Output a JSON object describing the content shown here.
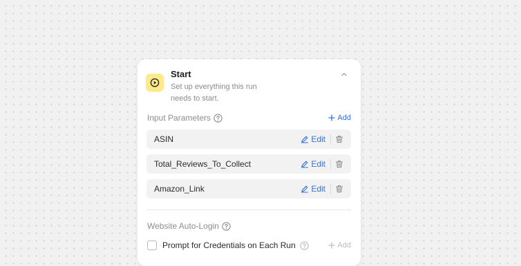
{
  "start_node": {
    "title": "Start",
    "subtitle": "Set up everything this run needs to start.",
    "icon": "play-icon",
    "icon_bg": "#fbe98a",
    "collapsed": false
  },
  "input_parameters": {
    "label": "Input Parameters",
    "add_label": "Add",
    "items": [
      {
        "name": "ASIN",
        "edit_label": "Edit"
      },
      {
        "name": "Total_Reviews_To_Collect",
        "edit_label": "Edit"
      },
      {
        "name": "Amazon_Link",
        "edit_label": "Edit"
      }
    ]
  },
  "website_auto_login": {
    "label": "Website Auto-Login",
    "checkbox_label": "Prompt for Credentials on Each Run",
    "checked": false,
    "add_label": "Add",
    "add_enabled": false
  },
  "colors": {
    "accent": "#2f6fde",
    "row_bg": "#f2f2f2",
    "canvas_bg": "#f1f1f1"
  }
}
